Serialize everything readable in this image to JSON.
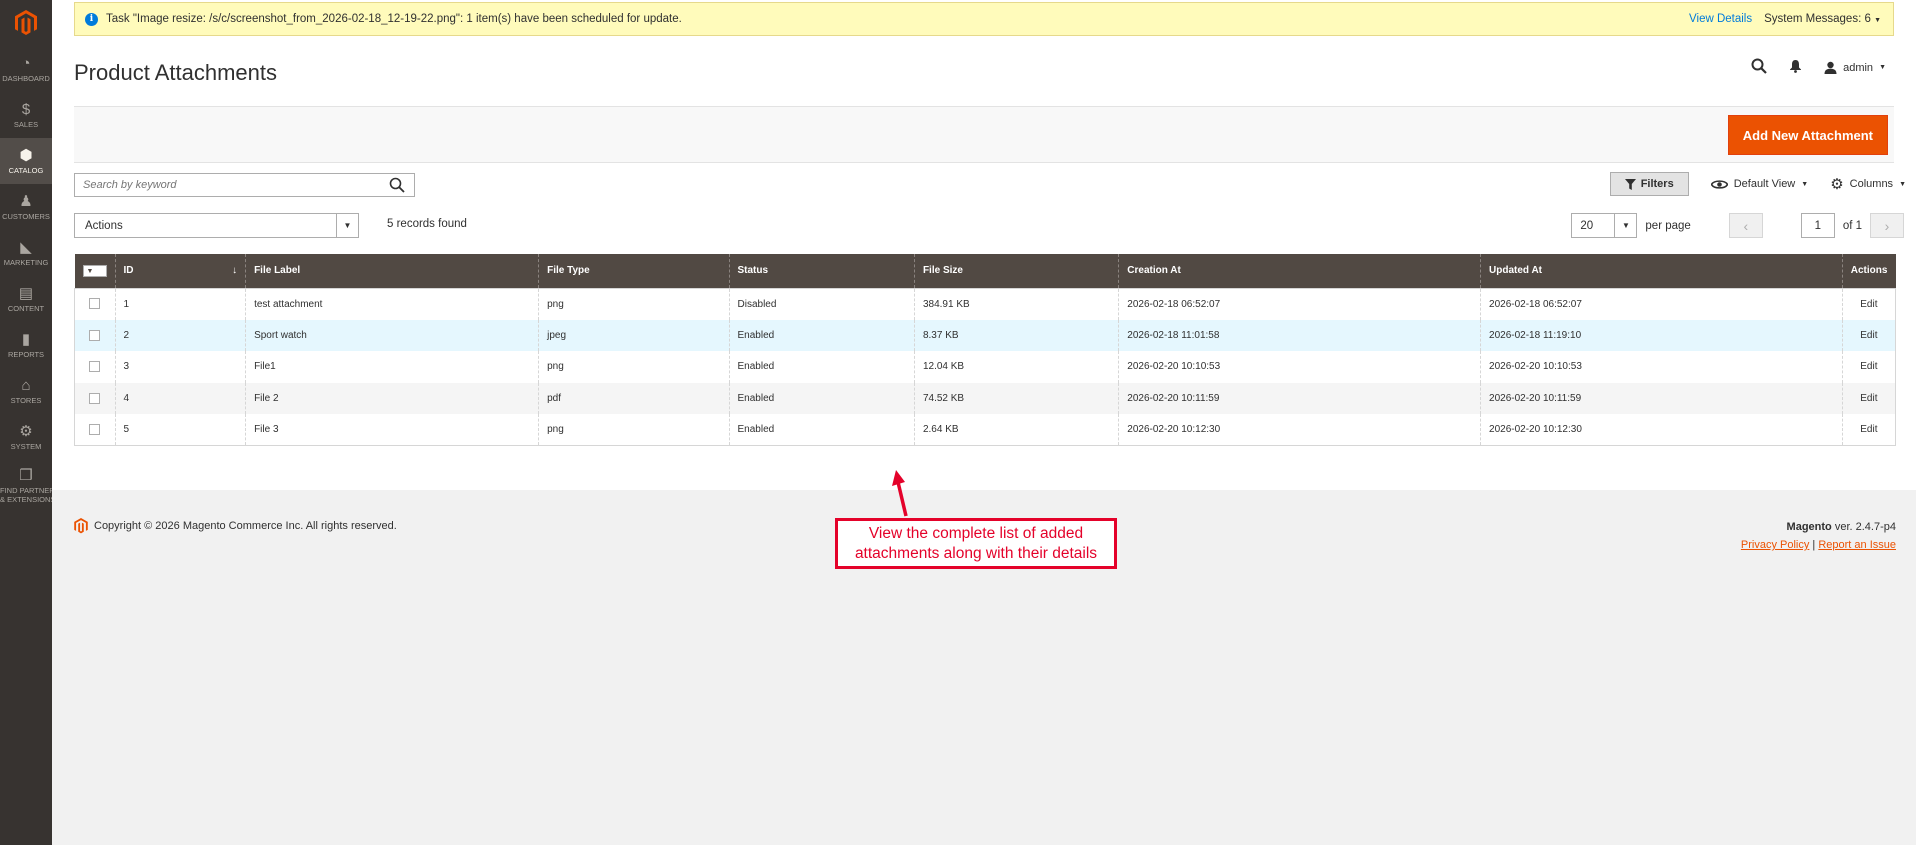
{
  "sidebar": {
    "items": [
      {
        "label": "DASHBOARD",
        "icon": "dashboard-icon"
      },
      {
        "label": "SALES",
        "icon": "dollar-icon"
      },
      {
        "label": "CATALOG",
        "icon": "cube-icon"
      },
      {
        "label": "CUSTOMERS",
        "icon": "person-icon"
      },
      {
        "label": "MARKETING",
        "icon": "megaphone-icon"
      },
      {
        "label": "CONTENT",
        "icon": "content-icon"
      },
      {
        "label": "REPORTS",
        "icon": "bar-chart-icon"
      },
      {
        "label": "STORES",
        "icon": "store-icon"
      },
      {
        "label": "SYSTEM",
        "icon": "gear-icon"
      },
      {
        "label1": "FIND PARTNERS",
        "label2": "& EXTENSIONS",
        "icon": "boxes-icon"
      }
    ]
  },
  "system_message": {
    "text": "Task \"Image resize: /s/c/screenshot_from_2026-02-18_12-19-22.png\": 1 item(s) have been scheduled for update.",
    "view_details": "View Details",
    "system_messages": "System Messages: 6"
  },
  "header": {
    "title": "Product Attachments",
    "user": "admin"
  },
  "toolbar": {
    "add_button": "Add New Attachment"
  },
  "search": {
    "placeholder": "Search by keyword"
  },
  "grid_tools": {
    "filters": "Filters",
    "view": "Default View",
    "columns": "Columns"
  },
  "mass_actions": {
    "label": "Actions",
    "records_found": "5 records found"
  },
  "pager": {
    "per_page_value": "20",
    "per_page_label": "per page",
    "current_page": "1",
    "of_pages": "of 1"
  },
  "table": {
    "columns": [
      "ID",
      "File Label",
      "File Type",
      "Status",
      "File Size",
      "Creation At",
      "Updated At",
      "Actions"
    ],
    "sort_indicator": "↓",
    "rows": [
      {
        "id": "1",
        "label": "test attachment",
        "type": "png",
        "status": "Disabled",
        "size": "384.91 KB",
        "created": "2026-02-18 06:52:07",
        "updated": "2026-02-18 06:52:07",
        "action": "Edit"
      },
      {
        "id": "2",
        "label": "Sport watch",
        "type": "jpeg",
        "status": "Enabled",
        "size": "8.37 KB",
        "created": "2026-02-18 11:01:58",
        "updated": "2026-02-18 11:19:10",
        "action": "Edit"
      },
      {
        "id": "3",
        "label": "File1",
        "type": "png",
        "status": "Enabled",
        "size": "12.04 KB",
        "created": "2026-02-20 10:10:53",
        "updated": "2026-02-20 10:10:53",
        "action": "Edit"
      },
      {
        "id": "4",
        "label": "File 2",
        "type": "pdf",
        "status": "Enabled",
        "size": "74.52 KB",
        "created": "2026-02-20 10:11:59",
        "updated": "2026-02-20 10:11:59",
        "action": "Edit"
      },
      {
        "id": "5",
        "label": "File 3",
        "type": "png",
        "status": "Enabled",
        "size": "2.64 KB",
        "created": "2026-02-20 10:12:30",
        "updated": "2026-02-20 10:12:30",
        "action": "Edit"
      }
    ]
  },
  "footer": {
    "copyright": "Copyright © 2026 Magento Commerce Inc. All rights reserved.",
    "brand": "Magento",
    "version": "ver. 2.4.7-p4",
    "privacy": "Privacy Policy",
    "separator": "|",
    "report": "Report an Issue"
  },
  "annotation": {
    "line1": "View the complete list of added",
    "line2": "attachments along with their details"
  },
  "colors": {
    "accent": "#eb5202",
    "sidebar": "#373330",
    "table_header": "#514943",
    "link": "#007bdb",
    "annotation": "#e4022a"
  }
}
